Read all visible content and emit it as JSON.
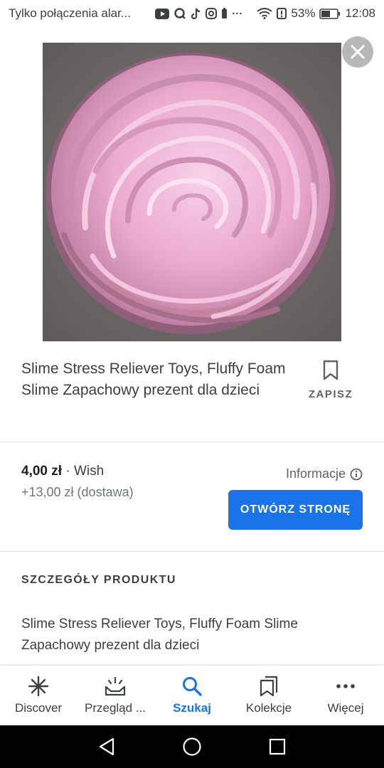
{
  "status_bar": {
    "left_text": "Tylko połączenia alar...",
    "icons": [
      "youtube-icon",
      "q-icon",
      "tiktok-icon",
      "instagram-icon",
      "battery-alert-icon",
      "more-icon"
    ],
    "battery": "53%",
    "time": "12:08"
  },
  "product": {
    "title": "Slime Stress Reliever Toys, Fluffy Foam Slime Zapachowy prezent dla dzieci",
    "save_label": "ZAPISZ",
    "price": "4,00 zł",
    "separator": " · ",
    "seller": "Wish",
    "shipping": "+13,00 zł (dostawa)",
    "info_label": "Informacje",
    "open_button": "OTWÓRZ STRONĘ"
  },
  "details": {
    "section_title": "SZCZEGÓŁY PRODUKTU",
    "description": "Slime Stress Reliever Toys, Fluffy Foam Slime Zapachowy prezent dla dzieci"
  },
  "bottom_nav": {
    "items": [
      {
        "label": "Discover",
        "icon": "asterisk-icon",
        "active": false
      },
      {
        "label": "Przegląd ...",
        "icon": "updates-icon",
        "active": false
      },
      {
        "label": "Szukaj",
        "icon": "search-icon",
        "active": true
      },
      {
        "label": "Kolekcje",
        "icon": "collections-icon",
        "active": false
      },
      {
        "label": "Więcej",
        "icon": "more-horizontal-icon",
        "active": false
      }
    ]
  },
  "colors": {
    "accent": "#1a73e8",
    "slime_pink": "#e9a9cf",
    "close_bg": "#b8b8b8"
  }
}
